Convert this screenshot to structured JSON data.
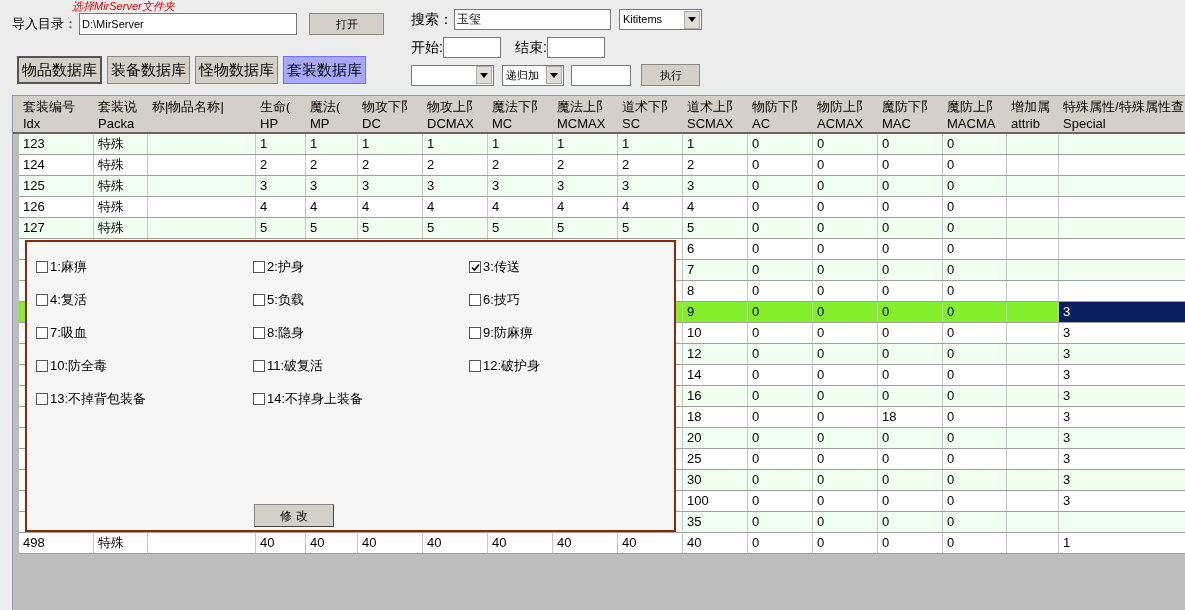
{
  "hint": "选择MirServer文件夹",
  "import": {
    "label": "导入目录：",
    "value": "D:\\MirServer",
    "button": "打开"
  },
  "db_tabs": [
    {
      "label": "物品数据库",
      "selected": false,
      "kind": "pressed"
    },
    {
      "label": "装备数据库",
      "selected": false,
      "kind": "plain"
    },
    {
      "label": "怪物数据库",
      "selected": false,
      "kind": "plain"
    },
    {
      "label": "套装数据库",
      "selected": true,
      "kind": "plain"
    }
  ],
  "search": {
    "label": "搜索：",
    "value": "玉玺",
    "table": "Kititems",
    "start_label": "开始:",
    "end_label": "结束:",
    "mode": "递归加",
    "button": "执行"
  },
  "table": {
    "columns": [
      {
        "name": "套装编号",
        "field": "Idx"
      },
      {
        "name": "套装说",
        "field": "Packa"
      },
      {
        "name": "称|物品名称|"
      },
      {
        "name": "生命(",
        "field": "HP"
      },
      {
        "name": "魔法(",
        "field": "MP"
      },
      {
        "name": "物攻下阝",
        "field": "DC"
      },
      {
        "name": "物攻上阝",
        "field": "DCMAX"
      },
      {
        "name": "魔法下阝",
        "field": "MC"
      },
      {
        "name": "魔法上阝",
        "field": "MCMAX"
      },
      {
        "name": "道术下阝",
        "field": "SC"
      },
      {
        "name": "道术上阝",
        "field": "SCMAX"
      },
      {
        "name": "物防下阝",
        "field": "AC"
      },
      {
        "name": "物防上阝",
        "field": "ACMAX"
      },
      {
        "name": "魔防下阝",
        "field": "MAC"
      },
      {
        "name": "魔防上阝",
        "field": "MACMA"
      },
      {
        "name": "增加属",
        "field": "attrib"
      },
      {
        "name": "特殊属性/特殊属性查",
        "field": "Special"
      }
    ],
    "rows": [
      {
        "selected": false,
        "cells": [
          "123",
          "特殊",
          null,
          "1",
          "1",
          "1",
          "1",
          "1",
          "1",
          "1",
          "1",
          "0",
          "0",
          "0",
          "0",
          null,
          null
        ]
      },
      {
        "selected": false,
        "cells": [
          "124",
          "特殊",
          null,
          "2",
          "2",
          "2",
          "2",
          "2",
          "2",
          "2",
          "2",
          "0",
          "0",
          "0",
          "0",
          null,
          null
        ]
      },
      {
        "selected": false,
        "cells": [
          "125",
          "特殊",
          null,
          "3",
          "3",
          "3",
          "3",
          "3",
          "3",
          "3",
          "3",
          "0",
          "0",
          "0",
          "0",
          null,
          null
        ]
      },
      {
        "selected": false,
        "cells": [
          "126",
          "特殊",
          null,
          "4",
          "4",
          "4",
          "4",
          "4",
          "4",
          "4",
          "4",
          "0",
          "0",
          "0",
          "0",
          null,
          null
        ]
      },
      {
        "selected": false,
        "cells": [
          "127",
          "特殊",
          null,
          "5",
          "5",
          "5",
          "5",
          "5",
          "5",
          "5",
          "5",
          "0",
          "0",
          "0",
          "0",
          null,
          null
        ]
      },
      {
        "selected": false,
        "cells": [
          null,
          null,
          null,
          null,
          null,
          null,
          null,
          null,
          null,
          null,
          "6",
          "0",
          "0",
          "0",
          "0",
          null,
          null
        ]
      },
      {
        "selected": false,
        "cells": [
          null,
          null,
          null,
          null,
          null,
          null,
          null,
          null,
          null,
          null,
          "7",
          "0",
          "0",
          "0",
          "0",
          null,
          null
        ]
      },
      {
        "selected": false,
        "cells": [
          null,
          null,
          null,
          null,
          null,
          null,
          null,
          null,
          null,
          null,
          "8",
          "0",
          "0",
          "0",
          "0",
          null,
          null
        ]
      },
      {
        "selected": true,
        "cells": [
          null,
          null,
          null,
          null,
          null,
          null,
          null,
          null,
          null,
          null,
          "9",
          "0",
          "0",
          "0",
          "0",
          null,
          "3"
        ]
      },
      {
        "selected": false,
        "cells": [
          null,
          null,
          null,
          null,
          null,
          null,
          null,
          null,
          null,
          null,
          "10",
          "0",
          "0",
          "0",
          "0",
          null,
          "3"
        ]
      },
      {
        "selected": false,
        "cells": [
          null,
          null,
          null,
          null,
          null,
          null,
          null,
          null,
          null,
          null,
          "12",
          "0",
          "0",
          "0",
          "0",
          null,
          "3"
        ]
      },
      {
        "selected": false,
        "cells": [
          null,
          null,
          null,
          null,
          null,
          null,
          null,
          null,
          null,
          null,
          "14",
          "0",
          "0",
          "0",
          "0",
          null,
          "3"
        ]
      },
      {
        "selected": false,
        "cells": [
          null,
          null,
          null,
          null,
          null,
          null,
          null,
          null,
          null,
          null,
          "16",
          "0",
          "0",
          "0",
          "0",
          null,
          "3"
        ]
      },
      {
        "selected": false,
        "cells": [
          null,
          null,
          null,
          null,
          null,
          null,
          null,
          null,
          null,
          null,
          "18",
          "0",
          "0",
          "18",
          "0",
          null,
          "3"
        ]
      },
      {
        "selected": false,
        "cells": [
          null,
          null,
          null,
          null,
          null,
          null,
          null,
          null,
          null,
          null,
          "20",
          "0",
          "0",
          "0",
          "0",
          null,
          "3"
        ]
      },
      {
        "selected": false,
        "cells": [
          null,
          null,
          null,
          null,
          null,
          null,
          null,
          null,
          null,
          null,
          "25",
          "0",
          "0",
          "0",
          "0",
          null,
          "3"
        ]
      },
      {
        "selected": false,
        "cells": [
          null,
          null,
          null,
          null,
          null,
          null,
          null,
          null,
          null,
          null,
          "30",
          "0",
          "0",
          "0",
          "0",
          null,
          "3"
        ]
      },
      {
        "selected": false,
        "cells": [
          null,
          null,
          null,
          null,
          null,
          null,
          null,
          null,
          null,
          null,
          "100",
          "0",
          "0",
          "0",
          "0",
          null,
          "3"
        ]
      },
      {
        "selected": false,
        "cells": [
          null,
          null,
          null,
          null,
          null,
          null,
          null,
          null,
          null,
          null,
          "35",
          "0",
          "0",
          "0",
          "0",
          null,
          null
        ]
      },
      {
        "selected": false,
        "cells": [
          "498",
          "特殊",
          null,
          "40",
          "40",
          "40",
          "40",
          "40",
          "40",
          "40",
          "40",
          "0",
          "0",
          "0",
          "0",
          null,
          "1"
        ]
      }
    ]
  },
  "dialog": {
    "options": [
      {
        "label": "1:麻痹",
        "checked": false
      },
      {
        "label": "2:护身",
        "checked": false
      },
      {
        "label": "3:传送",
        "checked": true
      },
      {
        "label": "4:复活",
        "checked": false
      },
      {
        "label": "5:负载",
        "checked": false
      },
      {
        "label": "6:技巧",
        "checked": false
      },
      {
        "label": "7:吸血",
        "checked": false
      },
      {
        "label": "8:隐身",
        "checked": false
      },
      {
        "label": "9:防麻痹",
        "checked": false
      },
      {
        "label": "10:防全毒",
        "checked": false
      },
      {
        "label": "11:破复活",
        "checked": false
      },
      {
        "label": "12:破护身",
        "checked": false
      },
      {
        "label": "13:不掉背包装备",
        "checked": false
      },
      {
        "label": "14:不掉身上装备",
        "checked": false
      }
    ],
    "button": "修 改"
  }
}
